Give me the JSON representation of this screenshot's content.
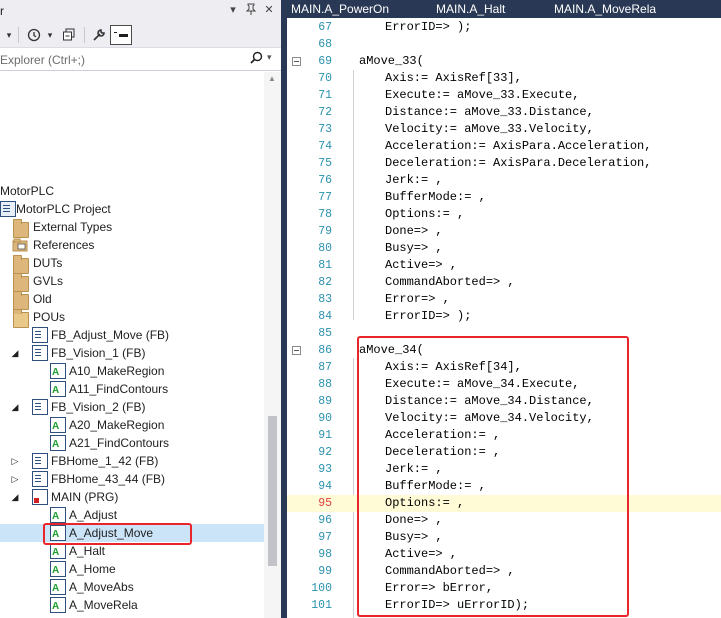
{
  "left_pane": {
    "title": "r",
    "title_buttons": [
      "▾",
      "📌",
      "✕"
    ],
    "search_placeholder": "Explorer (Ctrl+;)",
    "tree": [
      {
        "label": "MotorPLC",
        "icon": "plc-icon"
      },
      {
        "label": "MotorPLC Project",
        "icon": "project-icon"
      },
      {
        "label": "External Types",
        "icon": "folder-icon"
      },
      {
        "label": "References",
        "icon": "references-icon"
      },
      {
        "label": "DUTs",
        "icon": "folder-icon"
      },
      {
        "label": "GVLs",
        "icon": "folder-icon"
      },
      {
        "label": "Old",
        "icon": "folder-icon"
      },
      {
        "label": "POUs",
        "icon": "folder-open-icon"
      },
      {
        "label": "FB_Adjust_Move (FB)",
        "icon": "pou-icon"
      },
      {
        "label": "FB_Vision_1 (FB)",
        "icon": "pou-icon"
      },
      {
        "label": "A10_MakeRegion",
        "icon": "action-icon"
      },
      {
        "label": "A11_FindContours",
        "icon": "action-icon"
      },
      {
        "label": "FB_Vision_2 (FB)",
        "icon": "pou-icon"
      },
      {
        "label": "A20_MakeRegion",
        "icon": "action-icon"
      },
      {
        "label": "A21_FindContours",
        "icon": "action-icon"
      },
      {
        "label": "FBHome_1_42 (FB)",
        "icon": "pou-icon"
      },
      {
        "label": "FBHome_43_44 (FB)",
        "icon": "pou-icon"
      },
      {
        "label": "MAIN (PRG)",
        "icon": "program-icon"
      },
      {
        "label": "A_Adjust",
        "icon": "action-icon"
      },
      {
        "label": "A_Adjust_Move",
        "icon": "action-icon"
      },
      {
        "label": "A_Halt",
        "icon": "action-icon"
      },
      {
        "label": "A_Home",
        "icon": "action-icon"
      },
      {
        "label": "A_MoveAbs",
        "icon": "action-icon"
      },
      {
        "label": "A_MoveRela",
        "icon": "action-icon"
      }
    ]
  },
  "tabs": [
    "MAIN.A_PowerOn",
    "MAIN.A_Halt",
    "MAIN.A_MoveRela"
  ],
  "code_lines": [
    {
      "num": "67",
      "text": "ErrorID=> );"
    },
    {
      "num": "68",
      "text": ""
    },
    {
      "num": "69",
      "text": "aMove_33("
    },
    {
      "num": "70",
      "text": "Axis:= AxisRef[33],"
    },
    {
      "num": "71",
      "text": "Execute:= aMove_33.Execute,"
    },
    {
      "num": "72",
      "text": "Distance:= aMove_33.Distance,"
    },
    {
      "num": "73",
      "text": "Velocity:= aMove_33.Velocity,"
    },
    {
      "num": "74",
      "text": "Acceleration:= AxisPara.Acceleration,"
    },
    {
      "num": "75",
      "text": "Deceleration:= AxisPara.Deceleration,"
    },
    {
      "num": "76",
      "text": "Jerk:= ,"
    },
    {
      "num": "77",
      "text": "BufferMode:= ,"
    },
    {
      "num": "78",
      "text": "Options:= ,"
    },
    {
      "num": "79",
      "text": "Done=> ,"
    },
    {
      "num": "80",
      "text": "Busy=> ,"
    },
    {
      "num": "81",
      "text": "Active=> ,"
    },
    {
      "num": "82",
      "text": "CommandAborted=> ,"
    },
    {
      "num": "83",
      "text": "Error=> ,"
    },
    {
      "num": "84",
      "text": "ErrorID=> );"
    },
    {
      "num": "85",
      "text": ""
    },
    {
      "num": "86",
      "text": "aMove_34("
    },
    {
      "num": "87",
      "text": "Axis:= AxisRef[34],"
    },
    {
      "num": "88",
      "text": "Execute:= aMove_34.Execute,"
    },
    {
      "num": "89",
      "text": "Distance:= aMove_34.Distance,"
    },
    {
      "num": "90",
      "text": "Velocity:= aMove_34.Velocity,"
    },
    {
      "num": "91",
      "text": "Acceleration:= ,"
    },
    {
      "num": "92",
      "text": "Deceleration:= ,"
    },
    {
      "num": "93",
      "text": "Jerk:= ,"
    },
    {
      "num": "94",
      "text": "BufferMode:= ,"
    },
    {
      "num": "95",
      "text": "Options:= ,"
    },
    {
      "num": "96",
      "text": "Done=> ,"
    },
    {
      "num": "97",
      "text": "Busy=> ,"
    },
    {
      "num": "98",
      "text": "Active=> ,"
    },
    {
      "num": "99",
      "text": "CommandAborted=> ,"
    },
    {
      "num": "100",
      "text": "Error=> bError,"
    },
    {
      "num": "101",
      "text": "ErrorID=> uErrorID);"
    }
  ]
}
